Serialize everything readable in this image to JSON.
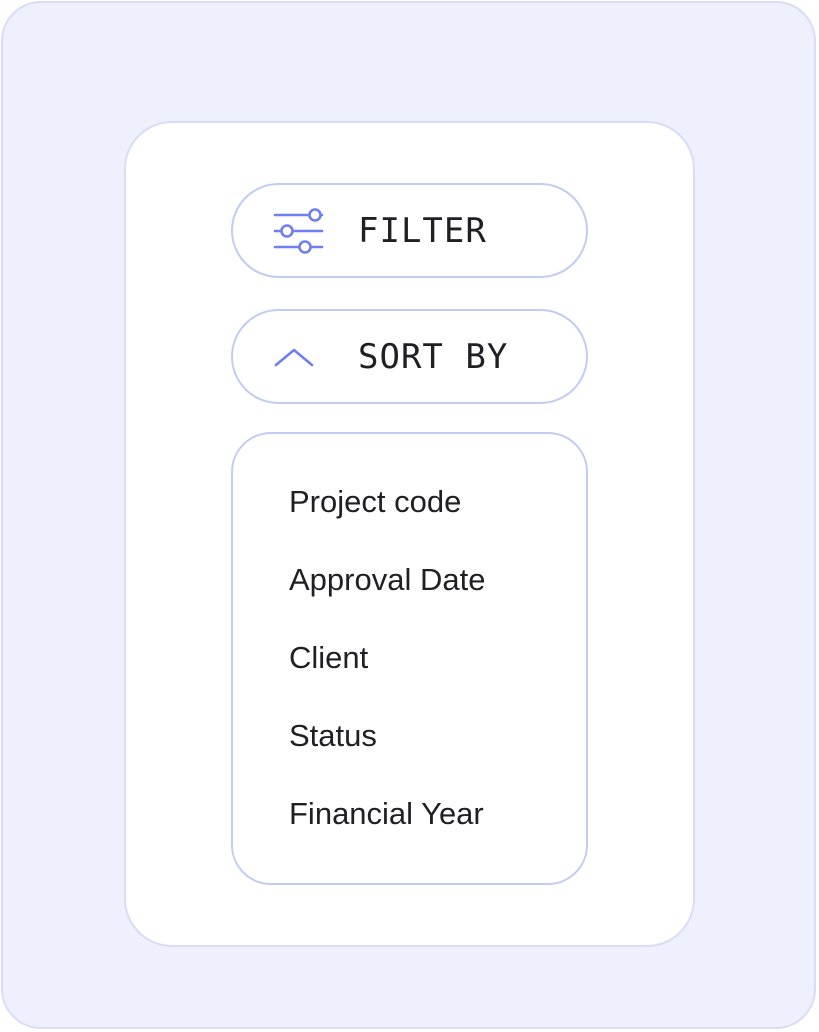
{
  "filter_button": {
    "label": "FILTER",
    "icon": "sliders-icon"
  },
  "sort_button": {
    "label": "SORT BY",
    "icon": "chevron-up-icon"
  },
  "sort_options": [
    {
      "label": "Project code"
    },
    {
      "label": "Approval Date"
    },
    {
      "label": "Client"
    },
    {
      "label": "Status"
    },
    {
      "label": "Financial Year"
    }
  ],
  "colors": {
    "background": "#eef0fd",
    "panel": "#ffffff",
    "border": "#c2ccf3",
    "accent": "#6f7ef0",
    "text": "#1f1f24"
  }
}
